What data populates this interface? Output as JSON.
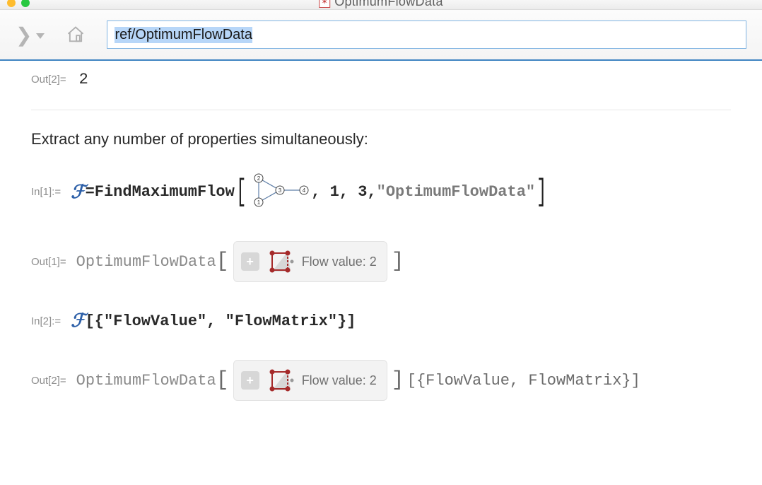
{
  "window": {
    "tab_title": "OptimumFlowData"
  },
  "address": {
    "value": "ref/OptimumFlowData"
  },
  "top_out": {
    "label": "Out[2]=",
    "value": "2"
  },
  "desc": "Extract any number of properties simultaneously:",
  "in1": {
    "label": "In[1]:=",
    "varsym": "ℱ",
    "eq": " = ",
    "fn": "FindMaximumFlow",
    "args_tail": ", 1, 3, ",
    "str": "\"OptimumFlowData\""
  },
  "out1": {
    "label": "Out[1]=",
    "head": "OptimumFlowData",
    "flow_label": "Flow value: 2"
  },
  "in2": {
    "label": "In[2]:=",
    "varsym": "ℱ",
    "body": "[{\"FlowValue\", \"FlowMatrix\"}]"
  },
  "out2": {
    "label": "Out[2]=",
    "head": "OptimumFlowData",
    "flow_label": "Flow value: 2",
    "tail": "[{FlowValue, FlowMatrix}]"
  }
}
